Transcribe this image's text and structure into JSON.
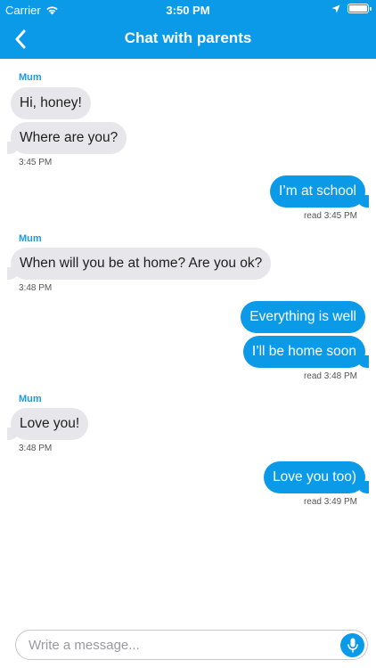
{
  "status_bar": {
    "carrier": "Carrier",
    "time": "3:50 PM"
  },
  "nav": {
    "title": "Chat with parents"
  },
  "messages": [
    {
      "sender": "Mum",
      "direction": "in",
      "texts": [
        "Hi, honey!",
        "Where are you?"
      ],
      "time": "3:45 PM"
    },
    {
      "direction": "out",
      "texts": [
        "I’m at school"
      ],
      "time": "read 3:45 PM"
    },
    {
      "sender": "Mum",
      "direction": "in",
      "texts": [
        "When will you be at home? Are you ok?"
      ],
      "time": "3:48 PM"
    },
    {
      "direction": "out",
      "texts": [
        "Everything is well",
        "I’ll be home soon"
      ],
      "time": "read 3:48 PM"
    },
    {
      "sender": "Mum",
      "direction": "in",
      "texts": [
        "Love you!"
      ],
      "time": "3:48 PM"
    },
    {
      "direction": "out",
      "texts": [
        "Love you too)"
      ],
      "time": "read 3:49 PM"
    }
  ],
  "composer": {
    "placeholder": "Write a message..."
  },
  "colors": {
    "accent": "#0a9ae8",
    "incoming_bubble": "#e6e6eb",
    "sender_name": "#1e9be0"
  }
}
